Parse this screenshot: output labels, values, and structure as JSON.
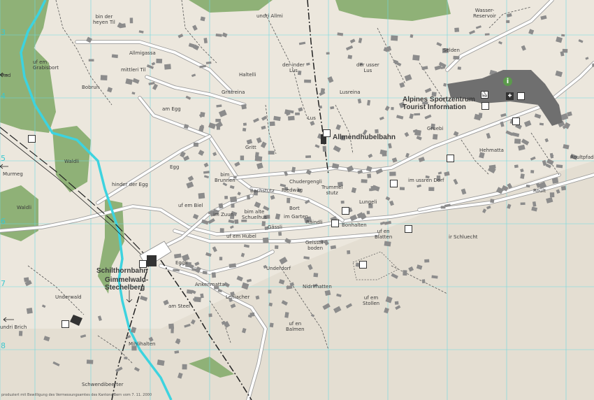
{
  "colors": {
    "background": "#ece7dd",
    "meadow": "#8fb177",
    "river": "#3dd3df",
    "grid": "#6fd9df",
    "building": "#8c8c8c",
    "road": "#ffffff",
    "road_edge": "#9a9a9a",
    "path": "#555555",
    "cableway": "#222222"
  },
  "grid_labels": [
    "3",
    "4",
    "5",
    "6",
    "7",
    "8"
  ],
  "places": {
    "bin_der_heyen_til": "bin der\nheyen Til",
    "undri_allmi": "undri Allmi",
    "wasser_reservoir": "Wasser-\nReservoir",
    "allmigassa": "Allmigassa",
    "selden": "Selden",
    "uf_em_grabisbort": "uf em\nGrabisbort",
    "mittleri_til": "mittleri Til",
    "haltelli": "Haltelli",
    "der_inder_lus": "der inder\nLus",
    "der_usser_lus": "der usser\nLus",
    "bobrun": "Bobrun",
    "grittreina": "Grittreina",
    "lusreina": "Lusreina",
    "am_egg": "am Egg",
    "lus": "Lus",
    "gruebi": "Gruebi",
    "waldli_1": "Waldli",
    "gritt": "Gritt",
    "hehmatta": "Hehmatta",
    "roultpfad": "Roultpfad",
    "egg": "Egg",
    "bim_brunnen": "bim\nBrunnen",
    "chuderguengli": "Chudergengli",
    "im_ussren_dorf": "im ussren Dorf",
    "hinder_der_egg": "hinder der Egg",
    "bachstutz": "Bachstutz",
    "riedweg": "Riedwäg",
    "trummelstutz": "Trummel\nstutz",
    "roult": "Roult",
    "waldli_2": "Waldli",
    "uf_em_biel": "uf em Biel",
    "lungeli": "Lungeli",
    "bort": "Bort",
    "im_zuun": "im Zuun",
    "bim_alte_schuelhus": "bim alte\nSchuelhus",
    "im_garten": "im Garten",
    "raindli": "Raindli",
    "bonhalten": "Bonhalten",
    "uf_en_blatten": "uf en\nBlatten",
    "gassli": "Gässli",
    "ir_schluecht": "ir Schluecht",
    "uf_em_hubel": "uf em Hubel",
    "geisstilboden": "Geisstil-\nboden",
    "eggli": "Eggli",
    "underdorf": "Underdorf",
    "ankenmatta": "Ankenmatta",
    "nidrimatten": "Nidrimatten",
    "underwald": "Underwald",
    "leniacher": "Leniacher",
    "uf_em_stollen": "uf em\nStollen",
    "am_steel": "am Steel",
    "undri_brich": "undri Brich",
    "uf_en_balmen": "uf en\nBalmen",
    "mihlihalten": "Mihlihalten",
    "schwendibeerter": "Schwendibeerter",
    "murmeg": "Murmeg",
    "rad": "Rad"
  },
  "bold_labels": {
    "sportzentrum": "Alpines Sportzentrum\nTourist Information",
    "allmendhubelbahn": "Allmendhubelbahn",
    "schilthornbahn": "Schilthornbahn",
    "gimmelwald": "Gimmelwald-\nStechelberg"
  },
  "icons": {
    "info": "i",
    "medical": "✚"
  },
  "footer": "produziert mit Bewilligung des Vermessungsamtes des Kantons Bern vom 7. 11. 2000"
}
